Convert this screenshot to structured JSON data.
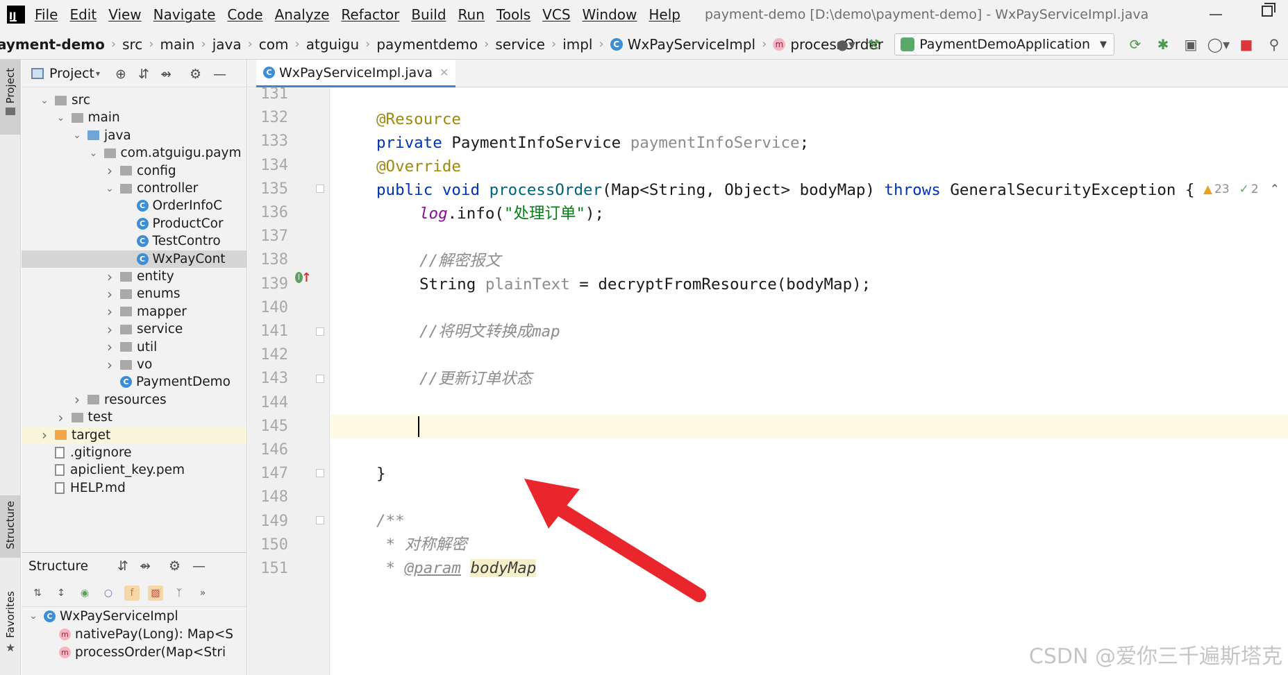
{
  "menubar": {
    "logo": "IJ",
    "items": [
      "File",
      "Edit",
      "View",
      "Navigate",
      "Code",
      "Analyze",
      "Refactor",
      "Build",
      "Run",
      "Tools",
      "VCS",
      "Window",
      "Help"
    ],
    "window_title": "payment-demo [D:\\demo\\payment-demo] - WxPayServiceImpl.java"
  },
  "navbar": {
    "crumbs": [
      "ayment-demo",
      "src",
      "main",
      "java",
      "com",
      "atguigu",
      "paymentdemo",
      "service",
      "impl",
      "WxPayServiceImpl",
      "processOrder"
    ],
    "run_config": "PaymentDemoApplication"
  },
  "stripe": {
    "project": "Project",
    "structure": "Structure",
    "favorites": "Favorites"
  },
  "project_panel": {
    "title": "Project",
    "tree": [
      {
        "label": "src",
        "level": 1,
        "arrow": "open",
        "icon": "folder"
      },
      {
        "label": "main",
        "level": 2,
        "arrow": "open",
        "icon": "folder"
      },
      {
        "label": "java",
        "level": 3,
        "arrow": "open",
        "icon": "folder-blue"
      },
      {
        "label": "com.atguigu.paym",
        "level": 4,
        "arrow": "open",
        "icon": "folder"
      },
      {
        "label": "config",
        "level": 5,
        "arrow": "closed",
        "icon": "folder"
      },
      {
        "label": "controller",
        "level": 5,
        "arrow": "open",
        "icon": "folder"
      },
      {
        "label": "OrderInfoC",
        "level": 6,
        "arrow": "none",
        "icon": "class"
      },
      {
        "label": "ProductCor",
        "level": 6,
        "arrow": "none",
        "icon": "class"
      },
      {
        "label": "TestContro",
        "level": 6,
        "arrow": "none",
        "icon": "class"
      },
      {
        "label": "WxPayCont",
        "level": 6,
        "arrow": "none",
        "icon": "class",
        "selected": true
      },
      {
        "label": "entity",
        "level": 5,
        "arrow": "closed",
        "icon": "folder"
      },
      {
        "label": "enums",
        "level": 5,
        "arrow": "closed",
        "icon": "folder"
      },
      {
        "label": "mapper",
        "level": 5,
        "arrow": "closed",
        "icon": "folder"
      },
      {
        "label": "service",
        "level": 5,
        "arrow": "closed",
        "icon": "folder"
      },
      {
        "label": "util",
        "level": 5,
        "arrow": "closed",
        "icon": "folder"
      },
      {
        "label": "vo",
        "level": 5,
        "arrow": "closed",
        "icon": "folder"
      },
      {
        "label": "PaymentDemo",
        "level": 5,
        "arrow": "none",
        "icon": "class"
      },
      {
        "label": "resources",
        "level": 3,
        "arrow": "closed",
        "icon": "folder"
      },
      {
        "label": "test",
        "level": 2,
        "arrow": "closed",
        "icon": "folder"
      },
      {
        "label": "target",
        "level": 1,
        "arrow": "closed",
        "icon": "folder-orange",
        "highlight": true
      },
      {
        "label": ".gitignore",
        "level": 1,
        "arrow": "none",
        "icon": "file"
      },
      {
        "label": "apiclient_key.pem",
        "level": 1,
        "arrow": "none",
        "icon": "file"
      },
      {
        "label": "HELP.md",
        "level": 1,
        "arrow": "none",
        "icon": "file"
      }
    ]
  },
  "structure_panel": {
    "title": "Structure",
    "class_name": "WxPayServiceImpl",
    "members": [
      "nativePay(Long): Map<S",
      "processOrder(Map<Stri"
    ]
  },
  "editor": {
    "tab_label": "WxPayServiceImpl.java",
    "warnings": "23",
    "typos": "2",
    "line_numbers": [
      "131",
      "132",
      "133",
      "134",
      "135",
      "136",
      "137",
      "138",
      "139",
      "140",
      "141",
      "142",
      "143",
      "144",
      "145",
      "146",
      "147",
      "148",
      "149",
      "150",
      "151"
    ],
    "code": {
      "l132": "@Resource",
      "l133_kw": "private",
      "l133_type": "PaymentInfoService",
      "l133_field": "paymentInfoService",
      "l134": "@Override",
      "l135_kw": "public void",
      "l135_fn": "processOrder",
      "l135_params": "(Map<String, Object> bodyMap)",
      "l135_throws": "throws",
      "l135_exc": "GeneralSecurityException {",
      "l136_log": "log",
      "l136_call": ".info(",
      "l136_str": "\"处理订单\"",
      "l136_end": ");",
      "l138": "//解密报文",
      "l139_type": "String",
      "l139_var": "plainText",
      "l139_rest": "= decryptFromResource(bodyMap);",
      "l141": "//将明文转换成map",
      "l143": "//更新订单状态",
      "l147": "}",
      "l149": "/**",
      "l150": " * 对称解密",
      "l151_tag": "@param",
      "l151_param": "bodyMap"
    }
  },
  "watermark": "CSDN @爱你三千遍斯塔克",
  "colors": {
    "arrow": "#e8262b",
    "accent": "#4083c9"
  }
}
